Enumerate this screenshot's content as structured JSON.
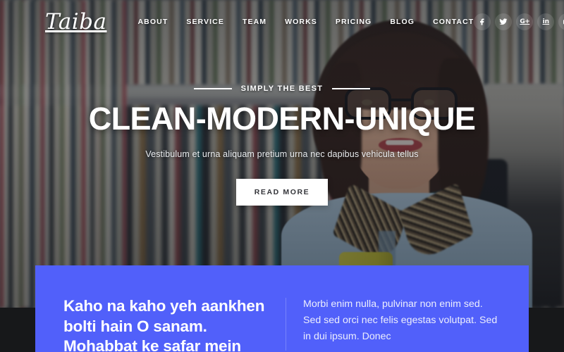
{
  "header": {
    "logo": "Taiba",
    "nav": [
      {
        "label": "ABOUT"
      },
      {
        "label": "SERVICE"
      },
      {
        "label": "TEAM"
      },
      {
        "label": "WORKS"
      },
      {
        "label": "PRICING"
      },
      {
        "label": "BLOG"
      },
      {
        "label": "CONTACT"
      }
    ],
    "socials": [
      {
        "name": "facebook-icon",
        "glyph": "f"
      },
      {
        "name": "twitter-icon",
        "glyph": "t"
      },
      {
        "name": "google-plus-icon",
        "glyph": "G+"
      },
      {
        "name": "linkedin-icon",
        "glyph": "in"
      },
      {
        "name": "youtube-icon",
        "glyph": "yt"
      }
    ]
  },
  "hero": {
    "eyebrow": "SIMPLY THE BEST",
    "title": "CLEAN-MODERN-UNIQUE",
    "subtitle": "Vestibulum et urna aliquam pretium urna nec dapibus vehicula tellus",
    "cta_label": "READ MORE"
  },
  "promo": {
    "heading": "Kaho na kaho yeh aankhen bolti hain O sanam. Mohabbat ke safar mein",
    "body": "Morbi enim nulla, pulvinar non enim sed. Sed sed orci nec felis egestas volutpat. Sed in dui ipsum. Donec"
  },
  "colors": {
    "panel_blue": "#5160fa",
    "page_dark": "#1a1a1c",
    "text_light": "#ffffff"
  }
}
